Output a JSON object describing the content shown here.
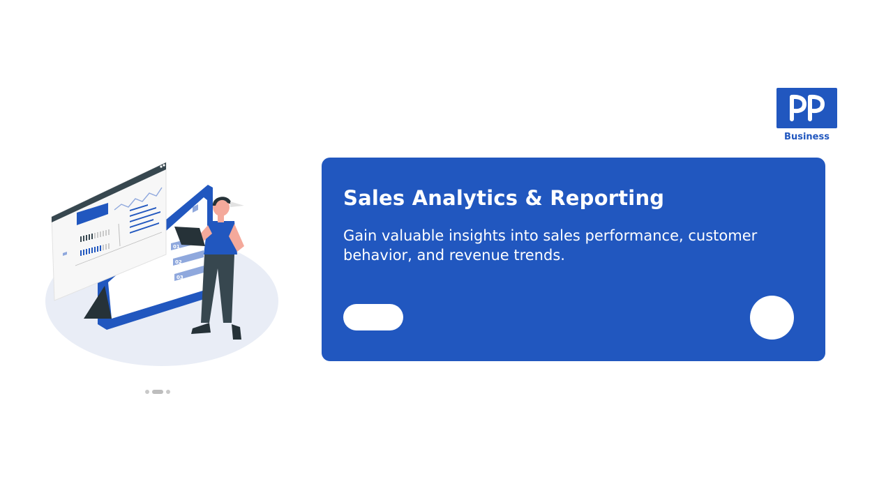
{
  "brand": {
    "logo_text": "PP",
    "label": "Business",
    "color": "#2157bf"
  },
  "illustration": {
    "icon": "analytics-dashboard-illustration",
    "list_labels": [
      "01",
      "02",
      "03"
    ]
  },
  "carousel": {
    "dot_count": 3,
    "active_index": 1
  },
  "card": {
    "title": "Sales Analytics & Reporting",
    "description": "Gain valuable insights into sales performance, customer behavior, and revenue trends.",
    "background": "#2157bf",
    "primary_button_label": "",
    "round_button_label": ""
  }
}
